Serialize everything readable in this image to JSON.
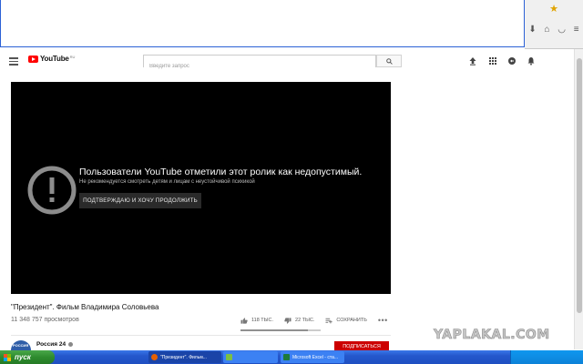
{
  "browser": {
    "toolbar_icons": [
      "star-icon",
      "bookmarks-icon",
      "download-icon",
      "home-icon",
      "pocket-icon",
      "menu-icon"
    ]
  },
  "header": {
    "logo_text": "YouTube",
    "logo_region": "RU",
    "search_placeholder": "Введите запрос",
    "icons": [
      "upload-icon",
      "apps-icon",
      "messages-icon",
      "notifications-icon"
    ]
  },
  "player": {
    "warning_title": "Пользователи YouTube отметили этот ролик как недопустимый.",
    "warning_subtitle": "Не рекомендуется смотреть детям и лицам с неустойчивой психикой",
    "confirm_button": "ПОДТВЕРЖДАЮ И ХОЧУ ПРОДОЛЖИТЬ"
  },
  "video": {
    "title": "\"Президент\". Фильм Владимира Соловьева",
    "views": "11 348 757 просмотров",
    "likes": "118 ТЫС.",
    "dislikes": "22 ТЫС.",
    "save_label": "СОХРАНИТЬ",
    "like_ratio": 0.84
  },
  "channel": {
    "name": "Россия 24",
    "avatar_text": "РОССИЯ",
    "subscribe_label": "ПОДПИСАТЬСЯ"
  },
  "watermark": "YAPLAKAL.COM",
  "taskbar": {
    "start_label": "пуск",
    "tasks": [
      {
        "label": "\"Президент\". Фильм...",
        "icon": "firefox-icon"
      },
      {
        "label": "",
        "icon": "app-icon"
      },
      {
        "label": "Microsoft Excel - ста...",
        "icon": "excel-icon"
      }
    ]
  },
  "colors": {
    "youtube_red": "#ff0000",
    "subscribe_red": "#cc0000",
    "taskbar_blue": "#2457cc",
    "start_green": "#2e8b2e"
  }
}
